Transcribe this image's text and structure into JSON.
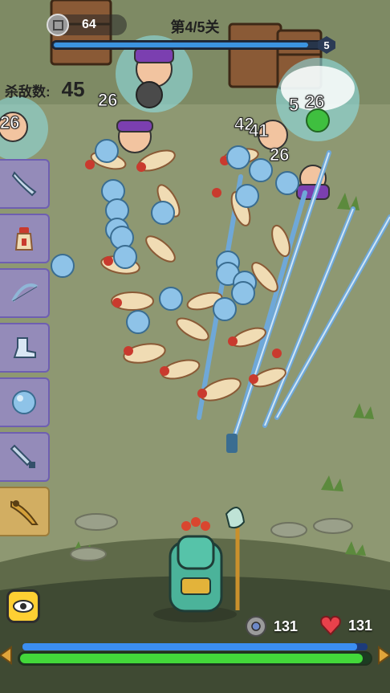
{
  "hud": {
    "coins": "64",
    "wave_label": "第4/5关",
    "wave_progress": 0.95,
    "wave_badge": "5",
    "kills_label": "杀敌数:",
    "kills_value": "45"
  },
  "skill_slots": [
    {
      "name": "sword-icon"
    },
    {
      "name": "bottle-icon"
    },
    {
      "name": "bow-icon"
    },
    {
      "name": "boots-icon"
    },
    {
      "name": "orb-icon"
    },
    {
      "name": "dagger-icon"
    },
    {
      "name": "dragon-blade-icon",
      "highlight": true
    }
  ],
  "damage_numbers": [
    "26",
    "26",
    "5",
    "26",
    "42",
    "41",
    "26",
    "26"
  ],
  "player": {
    "shield_value": "131",
    "health_value": "131",
    "mana_progress": 0.97,
    "hp_progress": 0.98
  },
  "colors": {
    "mana": "#3b8ef2",
    "hp": "#43d83a",
    "slot": "#9687d2",
    "eye_button": "#ffcf33"
  }
}
